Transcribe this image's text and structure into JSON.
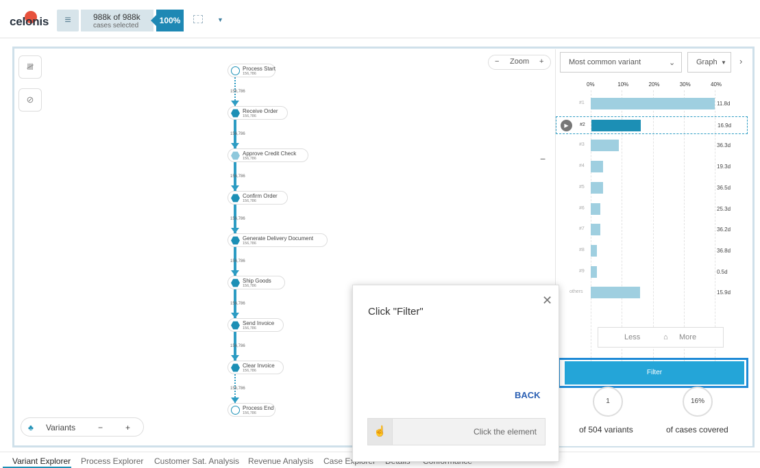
{
  "header": {
    "logo_text": "celonis",
    "menu_icon": "hamburger-icon",
    "cases_main": "988k of 988k",
    "cases_sub": "cases selected",
    "percent": "100%",
    "selection_icon": "selection-icon"
  },
  "toolbar": {
    "zoom_label": "Zoom",
    "zoom_minus": "−",
    "zoom_plus": "+",
    "collapse_minus": "−"
  },
  "process": {
    "nodes": [
      {
        "label": "Process Start",
        "count": "156,786"
      },
      {
        "label": "Receive Order",
        "count": "156,786"
      },
      {
        "label": "Approve Credit Check",
        "count": "156,786"
      },
      {
        "label": "Confirm Order",
        "count": "156,786"
      },
      {
        "label": "Generate Delivery Document",
        "count": "156,786"
      },
      {
        "label": "Ship Goods",
        "count": "156,786"
      },
      {
        "label": "Send Invoice",
        "count": "156,786"
      },
      {
        "label": "Clear Invoice",
        "count": "156,786"
      },
      {
        "label": "Process End",
        "count": "156,786"
      }
    ],
    "edge_value": "156,786"
  },
  "variants_bar": {
    "label": "Variants",
    "minus": "−",
    "plus": "+"
  },
  "right_panel": {
    "dropdown_value": "Most common variant",
    "graph_label": "Graph",
    "ticks": [
      "0%",
      "10%",
      "20%",
      "30%",
      "40%"
    ],
    "less_label": "Less",
    "more_label": "More",
    "filter_label": "Filter",
    "stat_variants_value": "1",
    "stat_variants_label": "of 504 variants",
    "stat_cases_value": "16%",
    "stat_cases_label": "of cases covered"
  },
  "chart_data": {
    "type": "bar",
    "categories": [
      "#1",
      "#2",
      "#3",
      "#4",
      "#5",
      "#6",
      "#7",
      "#8",
      "#9",
      "others"
    ],
    "values": [
      40,
      16,
      9,
      4,
      4,
      3,
      3,
      2,
      2,
      16
    ],
    "durations": [
      "11.8d",
      "16.9d",
      "36.3d",
      "19.3d",
      "36.5d",
      "25.3d",
      "36.2d",
      "36.8d",
      "0.5d",
      "15.9d"
    ],
    "xlim": [
      0,
      40
    ],
    "selected": "#2"
  },
  "tabs": [
    {
      "label": "Variant Explorer"
    },
    {
      "label": "Process Explorer"
    },
    {
      "label": "Customer Sat. Analysis"
    },
    {
      "label": "Revenue Analysis"
    },
    {
      "label": "Case Explorer"
    },
    {
      "label": "Details"
    },
    {
      "label": "Conformance"
    }
  ],
  "dialog": {
    "title": "Click \"Filter\"",
    "back_label": "BACK",
    "step_text": "Click the element"
  }
}
